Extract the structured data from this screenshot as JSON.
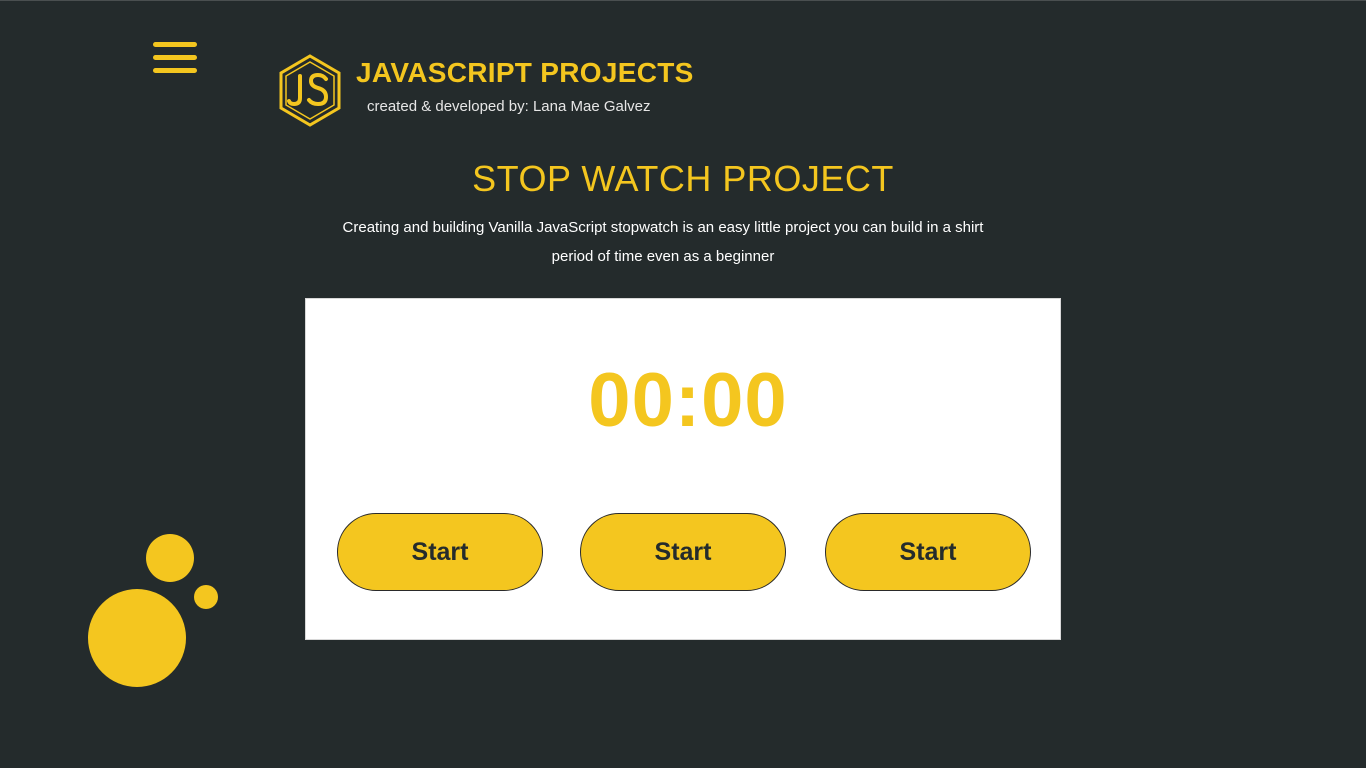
{
  "header": {
    "menu_icon": "hamburger-menu-icon",
    "logo_icon": "js-hexagon-logo-icon",
    "title": "JAVASCRIPT PROJECTS",
    "subtitle": "created & developed by: Lana Mae Galvez"
  },
  "main": {
    "title": "STOP WATCH PROJECT",
    "description": "Creating and building Vanilla JavaScript stopwatch is an easy little project you can build in a shirt period of time even as a beginner"
  },
  "stopwatch": {
    "display": "00:00",
    "buttons": [
      {
        "label": "Start"
      },
      {
        "label": "Start"
      },
      {
        "label": "Start"
      }
    ]
  },
  "theme": {
    "background": "#242b2c",
    "accent": "#f4c61f",
    "card": "#ffffff"
  }
}
